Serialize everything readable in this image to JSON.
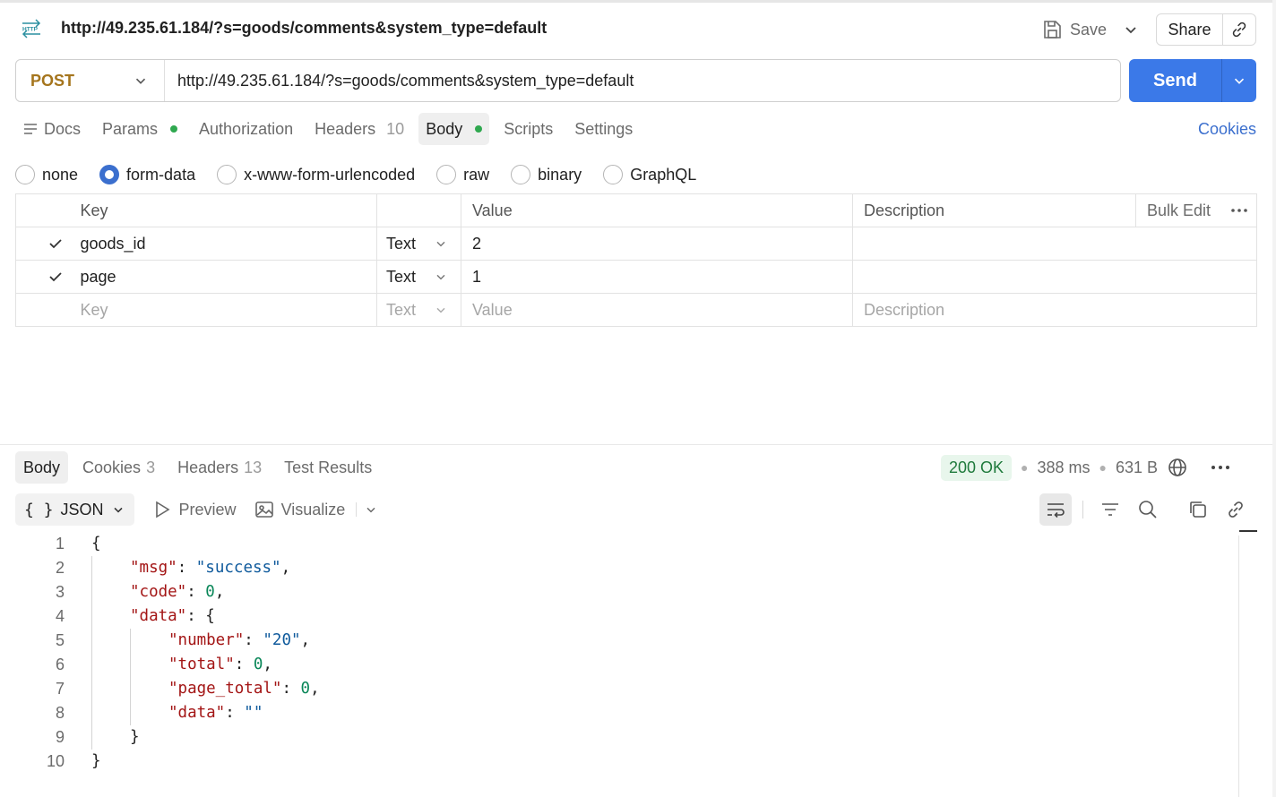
{
  "header": {
    "protocol_icon": "http-icon",
    "title": "http://49.235.61.184/?s=goods/comments&system_type=default",
    "save_label": "Save",
    "share_label": "Share"
  },
  "request": {
    "method": "POST",
    "url": "http://49.235.61.184/?s=goods/comments&system_type=default",
    "send_label": "Send",
    "method_color": "#a5751d",
    "accent_color": "#3b79e8"
  },
  "request_tabs": [
    {
      "label": "Docs"
    },
    {
      "label": "Params"
    },
    {
      "label": "Authorization"
    },
    {
      "label": "Headers",
      "count": "10"
    },
    {
      "label": "Body"
    },
    {
      "label": "Scripts"
    },
    {
      "label": "Settings"
    }
  ],
  "cookies_link": "Cookies",
  "body_types": [
    "none",
    "form-data",
    "x-www-form-urlencoded",
    "raw",
    "binary",
    "GraphQL"
  ],
  "body_type_selected": "form-data",
  "params": {
    "headers": {
      "key": "Key",
      "value": "Value",
      "description": "Description",
      "bulk_edit": "Bulk Edit"
    },
    "rows": [
      {
        "key": "goods_id",
        "type": "Text",
        "value": "2",
        "description": ""
      },
      {
        "key": "page",
        "type": "Text",
        "value": "1",
        "description": ""
      }
    ],
    "placeholder": {
      "key": "Key",
      "type": "Text",
      "value": "Value",
      "description": "Description"
    }
  },
  "response_tabs": [
    {
      "label": "Body"
    },
    {
      "label": "Cookies",
      "count": "3"
    },
    {
      "label": "Headers",
      "count": "13"
    },
    {
      "label": "Test Results"
    }
  ],
  "response_meta": {
    "status": "200 OK",
    "time": "388 ms",
    "size": "631 B",
    "status_color": "#1f7a3c"
  },
  "response_toolbar": {
    "format": "JSON",
    "preview": "Preview",
    "visualize": "Visualize"
  },
  "response_code": {
    "line_numbers": [
      "1",
      "2",
      "3",
      "4",
      "5",
      "6",
      "7",
      "8",
      "9",
      "10"
    ],
    "lines": [
      {
        "parts": [
          {
            "t": "p",
            "v": "{"
          }
        ]
      },
      {
        "parts": [
          {
            "t": "k",
            "v": "\"msg\""
          },
          {
            "t": "p",
            "v": ": "
          },
          {
            "t": "s",
            "v": "\"success\""
          },
          {
            "t": "p",
            "v": ","
          }
        ]
      },
      {
        "parts": [
          {
            "t": "k",
            "v": "\"code\""
          },
          {
            "t": "p",
            "v": ": "
          },
          {
            "t": "n",
            "v": "0"
          },
          {
            "t": "p",
            "v": ","
          }
        ]
      },
      {
        "parts": [
          {
            "t": "k",
            "v": "\"data\""
          },
          {
            "t": "p",
            "v": ": {"
          }
        ]
      },
      {
        "parts": [
          {
            "t": "k",
            "v": "\"number\""
          },
          {
            "t": "p",
            "v": ": "
          },
          {
            "t": "s",
            "v": "\"20\""
          },
          {
            "t": "p",
            "v": ","
          }
        ]
      },
      {
        "parts": [
          {
            "t": "k",
            "v": "\"total\""
          },
          {
            "t": "p",
            "v": ": "
          },
          {
            "t": "n",
            "v": "0"
          },
          {
            "t": "p",
            "v": ","
          }
        ]
      },
      {
        "parts": [
          {
            "t": "k",
            "v": "\"page_total\""
          },
          {
            "t": "p",
            "v": ": "
          },
          {
            "t": "n",
            "v": "0"
          },
          {
            "t": "p",
            "v": ","
          }
        ]
      },
      {
        "parts": [
          {
            "t": "k",
            "v": "\"data\""
          },
          {
            "t": "p",
            "v": ": "
          },
          {
            "t": "s",
            "v": "\"\""
          }
        ]
      },
      {
        "parts": [
          {
            "t": "p",
            "v": "}"
          }
        ]
      },
      {
        "parts": [
          {
            "t": "p",
            "v": "}"
          }
        ]
      }
    ]
  }
}
